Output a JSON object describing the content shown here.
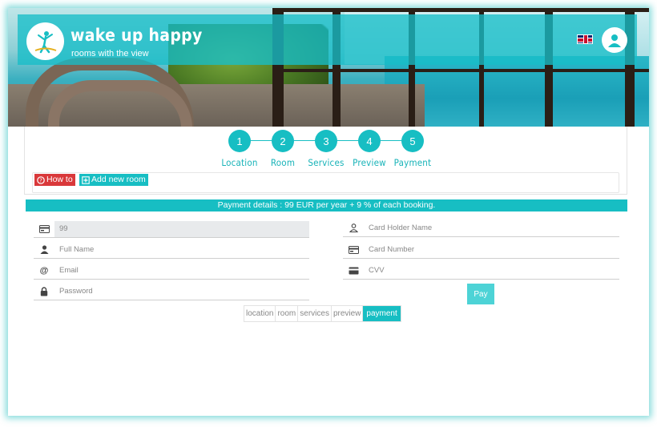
{
  "brand": {
    "title": "wake up happy",
    "subtitle": "rooms with the view"
  },
  "header": {
    "language": "English",
    "user_label": "account"
  },
  "steps": [
    {
      "number": "1",
      "label": "Location"
    },
    {
      "number": "2",
      "label": "Room"
    },
    {
      "number": "3",
      "label": "Services"
    },
    {
      "number": "4",
      "label": "Preview"
    },
    {
      "number": "5",
      "label": "Payment"
    }
  ],
  "toolbar": {
    "howto_label": "How to",
    "add_room_label": "Add new room"
  },
  "payment_banner": "Payment details : 99 EUR per year + 9 % of each booking.",
  "form": {
    "amount_value": "99",
    "full_name_placeholder": "Full Name",
    "email_placeholder": "Email",
    "password_placeholder": "Password",
    "card_holder_placeholder": "Card Holder Name",
    "card_number_placeholder": "Card Number",
    "cvv_placeholder": "CVV",
    "pay_label": "Pay"
  },
  "pager": [
    "location",
    "room",
    "services",
    "preview",
    "payment"
  ],
  "colors": {
    "accent": "#17bec3",
    "howto": "#d9383a"
  }
}
